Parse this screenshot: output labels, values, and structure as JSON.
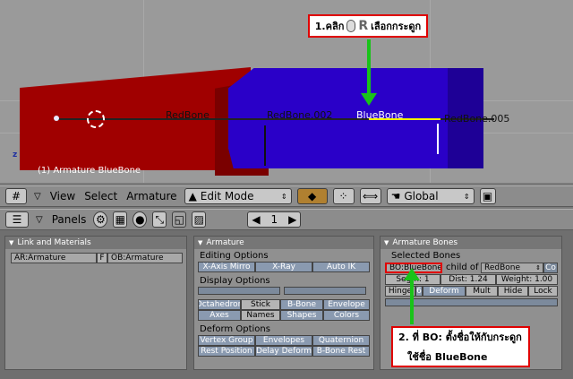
{
  "viewport": {
    "bones": [
      "RedBone",
      "RedBone.002",
      "BlueBone",
      "RedBone.005"
    ],
    "status": "(1) Armature BlueBone",
    "axis_label": "z",
    "colors": {
      "red": "#a00000",
      "blue": "#2a00c8",
      "bg": "#9a9a9a"
    }
  },
  "callout_top": {
    "prefix": "1.คลิก",
    "key": "R",
    "suffix": "เลือกกระดูก"
  },
  "callout_bottom": {
    "line1": "2. ที่ BO: ตั้งชื่อให้กับกระดูก",
    "line2": "ใช้ชื่อ  BlueBone"
  },
  "header1": {
    "menus": [
      "View",
      "Select",
      "Armature"
    ],
    "mode": "Edit Mode",
    "orientation": "Global"
  },
  "header2": {
    "panels_label": "Panels",
    "frame": "1"
  },
  "link_panel": {
    "title": "Link and Materials",
    "ar_field": "AR:Armature",
    "f_label": "F",
    "ob_field": "OB:Armature"
  },
  "armature_panel": {
    "title": "Armature",
    "editing_options": "Editing Options",
    "editing_buttons": [
      "X-Axis Mirro",
      "X-Ray",
      "Auto IK"
    ],
    "display_options": "Display Options",
    "display_row1": [
      "Octahedron",
      "Stick",
      "B-Bone",
      "Envelope"
    ],
    "display_row2": [
      "Axes",
      "Names",
      "Shapes",
      "Colors"
    ],
    "deform_options": "Deform Options",
    "deform_row1": [
      "Vertex Group",
      "Envelopes",
      "Quaternion"
    ],
    "deform_row2": [
      "Rest Position",
      "Delay Deform",
      "B-Bone Rest"
    ]
  },
  "bones_panel": {
    "title": "Armature Bones",
    "selected_label": "Selected Bones",
    "bo_field": "BO:BlueBone",
    "child_of": "child of",
    "parent": "RedBone",
    "co_label": "Co",
    "segm": "Segm: 1",
    "dist": "Dist: 1.24",
    "weight": "Weight: 1.00",
    "buttons": [
      "Hinge",
      "6",
      "Deform",
      "Mult",
      "Hide",
      "Lock"
    ]
  }
}
